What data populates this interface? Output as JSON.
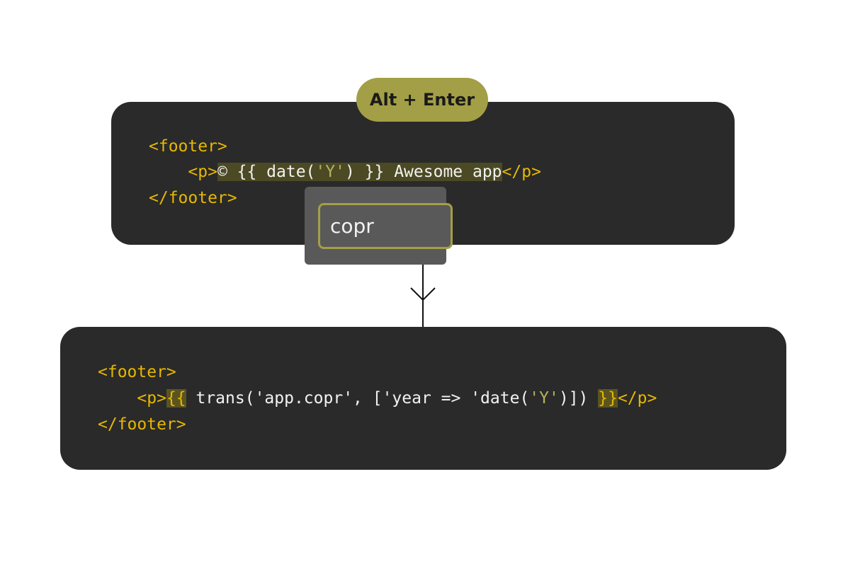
{
  "shortcut_badge": {
    "label": "Alt + Enter"
  },
  "before": {
    "line1_open": "<footer>",
    "line2_indent": "    ",
    "line2_open": "<p>",
    "line2_hl_a": "© {{ date(",
    "line2_hl_str": "'Y'",
    "line2_hl_b": ") }} Awesome app",
    "line2_close": "</p>",
    "line3_close": "</footer>"
  },
  "popup": {
    "input_value": "copr"
  },
  "after": {
    "line1_open": "<footer>",
    "line2_indent": "    ",
    "line2_open": "<p>",
    "line2_brace_open": "{{",
    "line2_a": " trans('app.copr', ['year => 'date(",
    "line2_str": "'Y'",
    "line2_b": ")]) ",
    "line2_brace_close": "}}",
    "line2_close": "</p>",
    "line3_close": "</footer>"
  }
}
